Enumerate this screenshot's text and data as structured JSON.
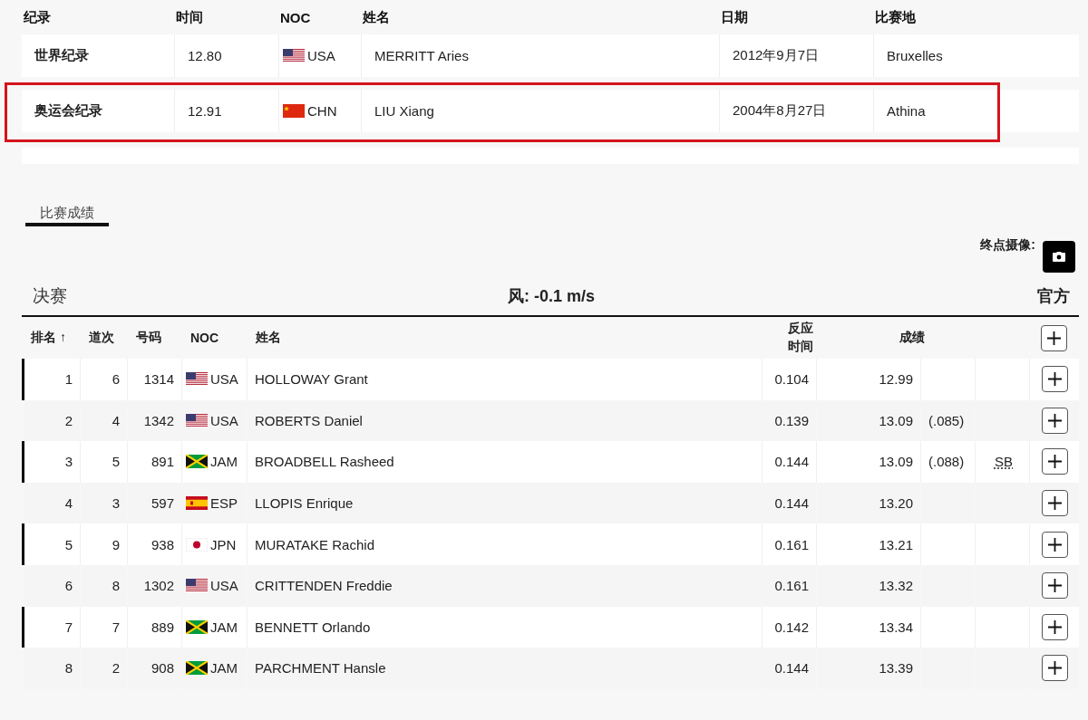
{
  "records": {
    "columns": [
      "纪录",
      "时间",
      "NOC",
      "姓名",
      "日期",
      "比赛地"
    ],
    "rows": [
      {
        "record": "世界纪录",
        "time": "12.80",
        "flag": {
          "kind": "us"
        },
        "noc": "USA",
        "name": "MERRITT Aries",
        "date": "2012年9月7日",
        "venue": "Bruxelles",
        "highlighted": false
      },
      {
        "record": "奥运会纪录",
        "time": "12.91",
        "flag": {
          "kind": "cn"
        },
        "noc": "CHN",
        "name": "LIU Xiang",
        "date": "2004年8月27日",
        "venue": "Athina",
        "highlighted": true
      }
    ]
  },
  "tabs": [
    {
      "label": "比赛成绩",
      "selected": true
    }
  ],
  "photo_finish": {
    "label": "终点摄像:"
  },
  "heat": {
    "title": "决赛",
    "wind": "风: -0.1 m/s",
    "status": "官方"
  },
  "results": {
    "columns": [
      "排名 ↑",
      "道次",
      "号码",
      "NOC",
      "姓名",
      "反应时间",
      "成绩"
    ],
    "rows": [
      {
        "rank": "1",
        "lane": "6",
        "bib": "1314",
        "flag": {
          "kind": "us"
        },
        "noc": "USA",
        "name": "HOLLOWAY Grant",
        "reaction": "0.104",
        "mark": "12.99"
      },
      {
        "rank": "2",
        "lane": "4",
        "bib": "1342",
        "flag": {
          "kind": "us"
        },
        "noc": "USA",
        "name": "ROBERTS Daniel",
        "reaction": "0.139",
        "mark": "13.09",
        "diff": "(.085)"
      },
      {
        "rank": "3",
        "lane": "5",
        "bib": "891",
        "flag": {
          "kind": "jm"
        },
        "noc": "JAM",
        "name": "BROADBELL Rasheed",
        "reaction": "0.144",
        "mark": "13.09",
        "diff": "(.088)",
        "record": "SB"
      },
      {
        "rank": "4",
        "lane": "3",
        "bib": "597",
        "flag": {
          "kind": "es"
        },
        "noc": "ESP",
        "name": "LLOPIS Enrique",
        "reaction": "0.144",
        "mark": "13.20"
      },
      {
        "rank": "5",
        "lane": "9",
        "bib": "938",
        "flag": {
          "kind": "jp"
        },
        "noc": "JPN",
        "name": "MURATAKE Rachid",
        "reaction": "0.161",
        "mark": "13.21"
      },
      {
        "rank": "6",
        "lane": "8",
        "bib": "1302",
        "flag": {
          "kind": "us"
        },
        "noc": "USA",
        "name": "CRITTENDEN Freddie",
        "reaction": "0.161",
        "mark": "13.32"
      },
      {
        "rank": "7",
        "lane": "7",
        "bib": "889",
        "flag": {
          "kind": "jm"
        },
        "noc": "JAM",
        "name": "BENNETT Orlando",
        "reaction": "0.142",
        "mark": "13.34"
      },
      {
        "rank": "8",
        "lane": "2",
        "bib": "908",
        "flag": {
          "kind": "jm"
        },
        "noc": "JAM",
        "name": "PARCHMENT Hansle",
        "reaction": "0.144",
        "mark": "13.39"
      }
    ]
  }
}
